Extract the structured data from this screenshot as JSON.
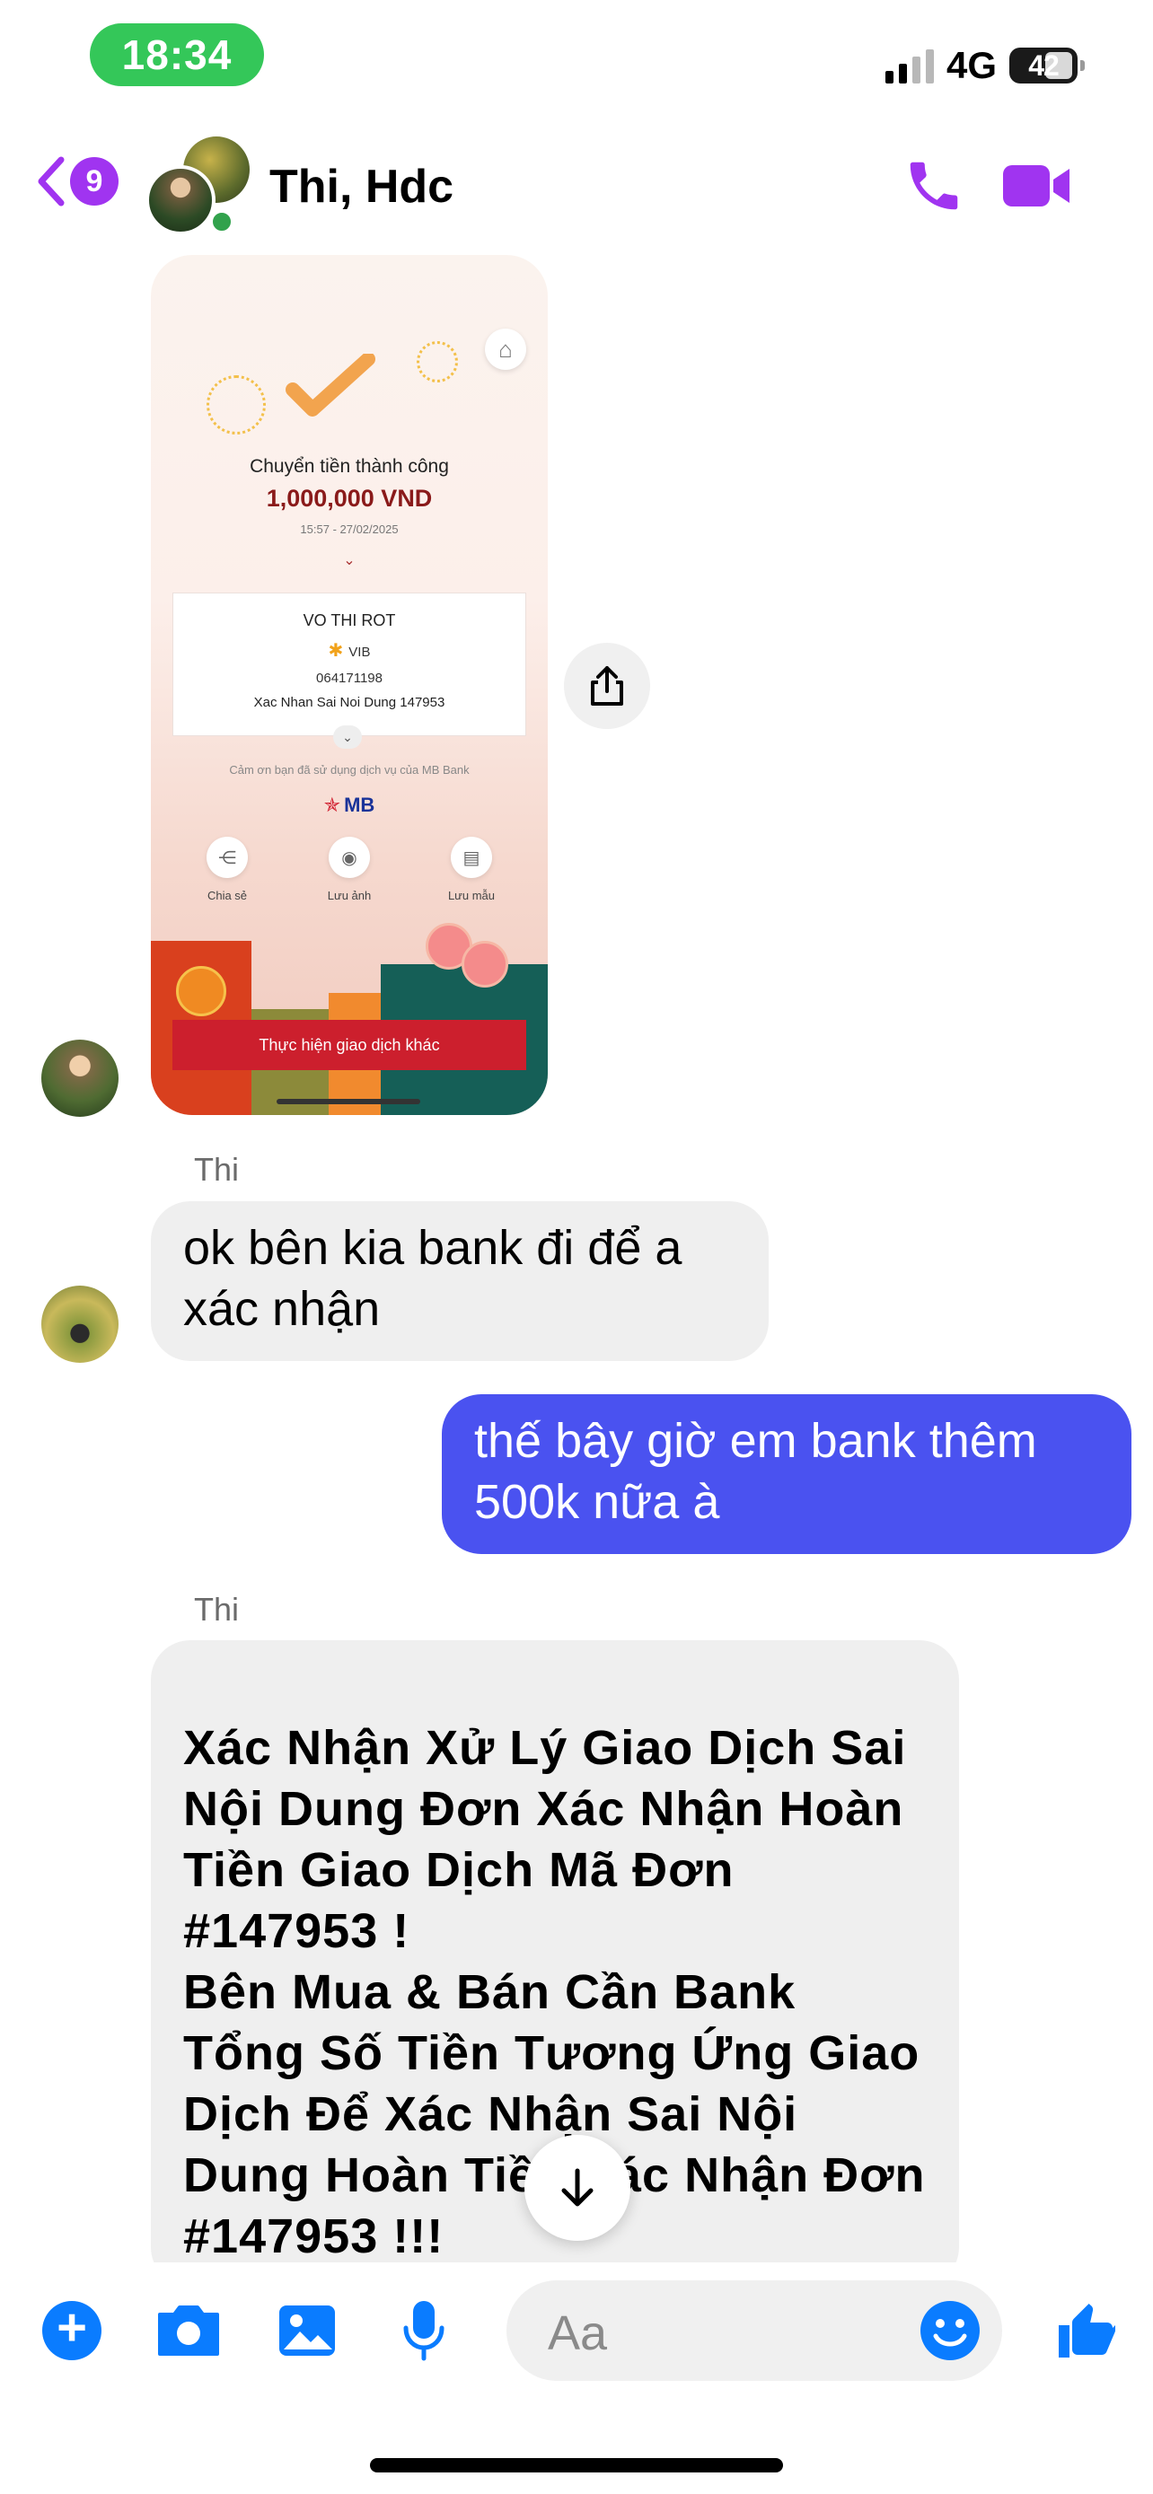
{
  "status_bar": {
    "time": "18:34",
    "network": "4G",
    "battery": "42"
  },
  "header": {
    "back_count": "9",
    "title": "Thi, Hdc"
  },
  "receipt": {
    "title": "Chuyển tiền thành công",
    "amount": "1,000,000 VND",
    "datetime": "15:57 - 27/02/2025",
    "recipient_name": "VO THI ROT",
    "bank": "VIB",
    "account": "064171198",
    "memo": "Xac Nhan Sai Noi Dung 147953",
    "thanks": "Cảm ơn bạn đã sử dụng dịch vụ của MB Bank",
    "brand": "MB",
    "actions": [
      "Chia sẻ",
      "Lưu ảnh",
      "Lưu mẫu"
    ],
    "cta": "Thực hiện giao dịch khác"
  },
  "messages": [
    {
      "sender": "Thi",
      "text": "ok bên kia bank đi để a xác nhận"
    },
    {
      "sender": "me",
      "text": "thế bây giờ em bank thêm 500k nữa à"
    },
    {
      "sender": "Thi",
      "text": "Xác Nhận Xử Lý Giao Dịch Sai Nội Dung Đơn Xác Nhận Hoàn Tiền Giao Dịch Mã Đơn #147953 !\n Bên Mua & Bán Cần Bank Tổng Số Tiền Tương Ứng Giao Dịch Để Xác Nhận Sai Nội Dung Hoàn Tiền Xác Nhận Đơn #147953 !!!\n______________________________"
    }
  ],
  "composer": {
    "placeholder": "Aa"
  },
  "colors": {
    "accent": "#a034f0",
    "outgoing_bubble": "#4a52f0",
    "incoming_bubble": "#efefef",
    "composer_blue": "#0a7cff"
  },
  "icons": [
    "back-chevron-icon",
    "phone-icon",
    "video-icon",
    "share-icon",
    "arrow-down-icon",
    "plus-icon",
    "camera-icon",
    "image-icon",
    "mic-icon",
    "emoji-icon",
    "thumbs-up-icon"
  ]
}
